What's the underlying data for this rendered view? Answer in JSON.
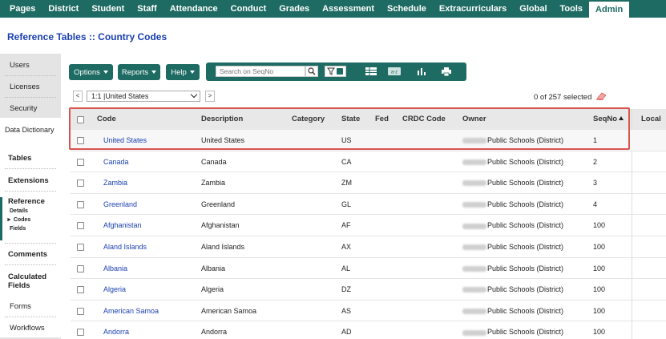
{
  "topnav": [
    "Pages",
    "District",
    "Student",
    "Staff",
    "Attendance",
    "Conduct",
    "Grades",
    "Assessment",
    "Schedule",
    "Extracurriculars",
    "Global",
    "Tools",
    "Admin"
  ],
  "page_title": "Reference Tables :: Country Codes",
  "sidebar": {
    "users": "Users",
    "licenses": "Licenses",
    "security": "Security",
    "data_dictionary": "Data Dictionary",
    "tables": "Tables",
    "extensions": "Extensions",
    "reference": "Reference",
    "reference_details": "Details",
    "reference_codes": "► Codes",
    "reference_fields": "Fields",
    "comments": "Comments",
    "calculated_fields": "Calculated Fields",
    "forms": "Forms",
    "workflows": "Workflows"
  },
  "toolbar": {
    "options": "Options",
    "reports": "Reports",
    "help": "Help",
    "search_placeholder": "Search on SeqNo"
  },
  "record_selector": {
    "prev": "<",
    "value": "1:1 |United States",
    "next": ">",
    "selected_count": "0 of 257 selected"
  },
  "table": {
    "columns": [
      "Code",
      "Description",
      "Category",
      "State",
      "Fed",
      "CRDC Code",
      "Owner",
      "SeqNo",
      "Local"
    ],
    "rows": [
      {
        "code": "United States",
        "description": "United States",
        "state": "US",
        "owner": "Public Schools (District)",
        "seqno": "1"
      },
      {
        "code": "Canada",
        "description": "Canada",
        "state": "CA",
        "owner": "Public Schools (District)",
        "seqno": "2"
      },
      {
        "code": "Zambia",
        "description": "Zambia",
        "state": "ZM",
        "owner": "Public Schools (District)",
        "seqno": "3"
      },
      {
        "code": "Greenland",
        "description": "Greenland",
        "state": "GL",
        "owner": "Public Schools (District)",
        "seqno": "4"
      },
      {
        "code": "Afghanistan",
        "description": "Afghanistan",
        "state": "AF",
        "owner": "Public Schools (District)",
        "seqno": "100"
      },
      {
        "code": "Aland Islands",
        "description": "Aland Islands",
        "state": "AX",
        "owner": "Public Schools (District)",
        "seqno": "100"
      },
      {
        "code": "Albania",
        "description": "Albania",
        "state": "AL",
        "owner": "Public Schools (District)",
        "seqno": "100"
      },
      {
        "code": "Algeria",
        "description": "Algeria",
        "state": "DZ",
        "owner": "Public Schools (District)",
        "seqno": "100"
      },
      {
        "code": "American Samoa",
        "description": "American Samoa",
        "state": "AS",
        "owner": "Public Schools (District)",
        "seqno": "100"
      },
      {
        "code": "Andorra",
        "description": "Andorra",
        "state": "AD",
        "owner": "Public Schools (District)",
        "seqno": "100"
      }
    ]
  },
  "colors": {
    "brand": "#1e6b63",
    "link": "#1a3fb0",
    "highlight": "#d9534f"
  }
}
